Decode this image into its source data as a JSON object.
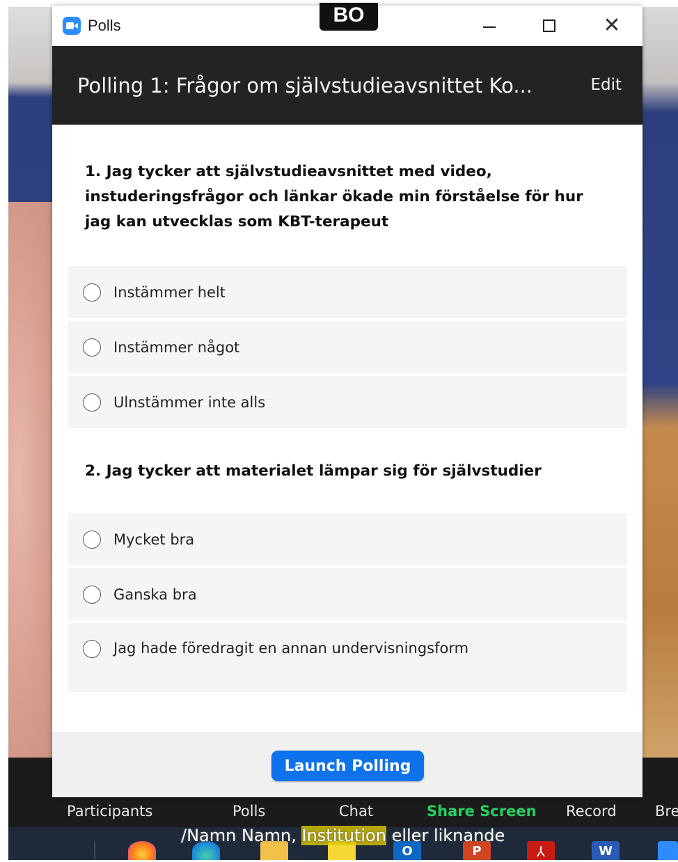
{
  "window": {
    "title": "Polls",
    "minimize_icon": "minimize-icon",
    "maximize_icon": "maximize-icon",
    "close_icon": "close-icon",
    "close_glyph": "✕"
  },
  "overlay_tag": "BO",
  "poll": {
    "title": "Polling 1: Frågor om självstudieavsnittet  Ko...",
    "edit_label": "Edit",
    "questions": [
      {
        "text": "1. Jag tycker att självstudieavsnittet med video, instuderingsfrågor och länkar ökade min förståelse för hur jag kan utvecklas som KBT-terapeut",
        "options": [
          "Instämmer helt",
          "Instämmer något",
          "Ulnstämmer inte alls"
        ]
      },
      {
        "text": "2. Jag tycker att materialet lämpar sig för självstudier",
        "options": [
          "Mycket bra",
          "Ganska bra",
          "Jag hade föredragit en annan undervisningsform"
        ]
      }
    ],
    "launch_button": "Launch Polling"
  },
  "toolbar": {
    "participants": "Participants",
    "polls": "Polls",
    "chat": "Chat",
    "share_screen": "Share Screen",
    "record": "Record",
    "breakout": "Bre"
  },
  "caption": {
    "part1": "/Namn Namn, ",
    "highlight": "Institution",
    "part2": " eller liknande"
  },
  "taskbar": {
    "icons": [
      "firefox-icon",
      "edge-icon",
      "file-explorer-icon",
      "sticky-notes-icon",
      "outlook-icon",
      "powerpoint-icon",
      "acrobat-icon",
      "word-icon",
      "zoom-icon"
    ],
    "outlook_glyph": "O",
    "ppt_glyph": "P",
    "pdf_glyph": "⅄",
    "word_glyph": "W"
  },
  "colors": {
    "header_bg": "#232323",
    "launch_button": "#0e72ed",
    "share_screen": "#23d160",
    "zoom_brand": "#2d8cff"
  }
}
